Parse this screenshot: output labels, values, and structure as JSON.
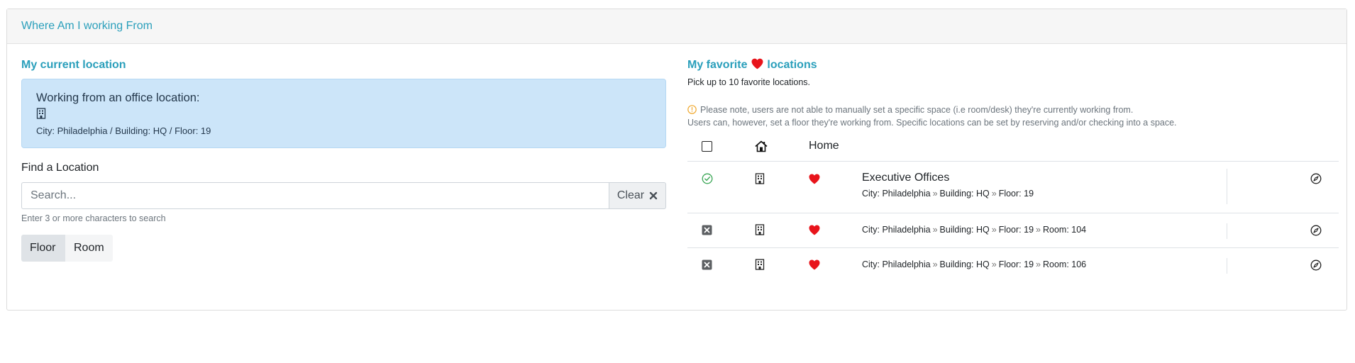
{
  "card": {
    "title": "Where Am I working From"
  },
  "current": {
    "title": "My current location",
    "heading": "Working from an office location:",
    "path": "City: Philadelphia / Building: HQ / Floor: 19",
    "icon": "building-icon"
  },
  "find": {
    "label": "Find a Location",
    "placeholder": "Search...",
    "clear_label": "Clear",
    "hint": "Enter 3 or more characters to search",
    "toggle": {
      "floor": "Floor",
      "room": "Room",
      "selected": "Floor"
    }
  },
  "favorites": {
    "title_before": "My favorite",
    "title_after": "locations",
    "subtitle": "Pick up to 10 favorite locations.",
    "note_line1": "Please note, users are not able to manually set a specific space (i.e room/desk) they're currently working from.",
    "note_line2": "Users can, however, set a floor they're working from. Specific locations can be set by reserving and/or checking into a space.",
    "header": {
      "home_label": "Home"
    },
    "separator": "»",
    "colors": {
      "accent": "#2a9fbb",
      "heart": "#e8141b",
      "check": "#3aa655"
    },
    "rows": [
      {
        "status": "current",
        "name": "Executive Offices",
        "p1": "City: Philadelphia",
        "p2": "Building: HQ",
        "p3": "Floor: 19",
        "p4": ""
      },
      {
        "status": "remove",
        "name": "",
        "p1": "City: Philadelphia",
        "p2": "Building: HQ",
        "p3": "Floor: 19",
        "p4": "Room: 104"
      },
      {
        "status": "remove",
        "name": "",
        "p1": "City: Philadelphia",
        "p2": "Building: HQ",
        "p3": "Floor: 19",
        "p4": "Room: 106"
      }
    ]
  }
}
